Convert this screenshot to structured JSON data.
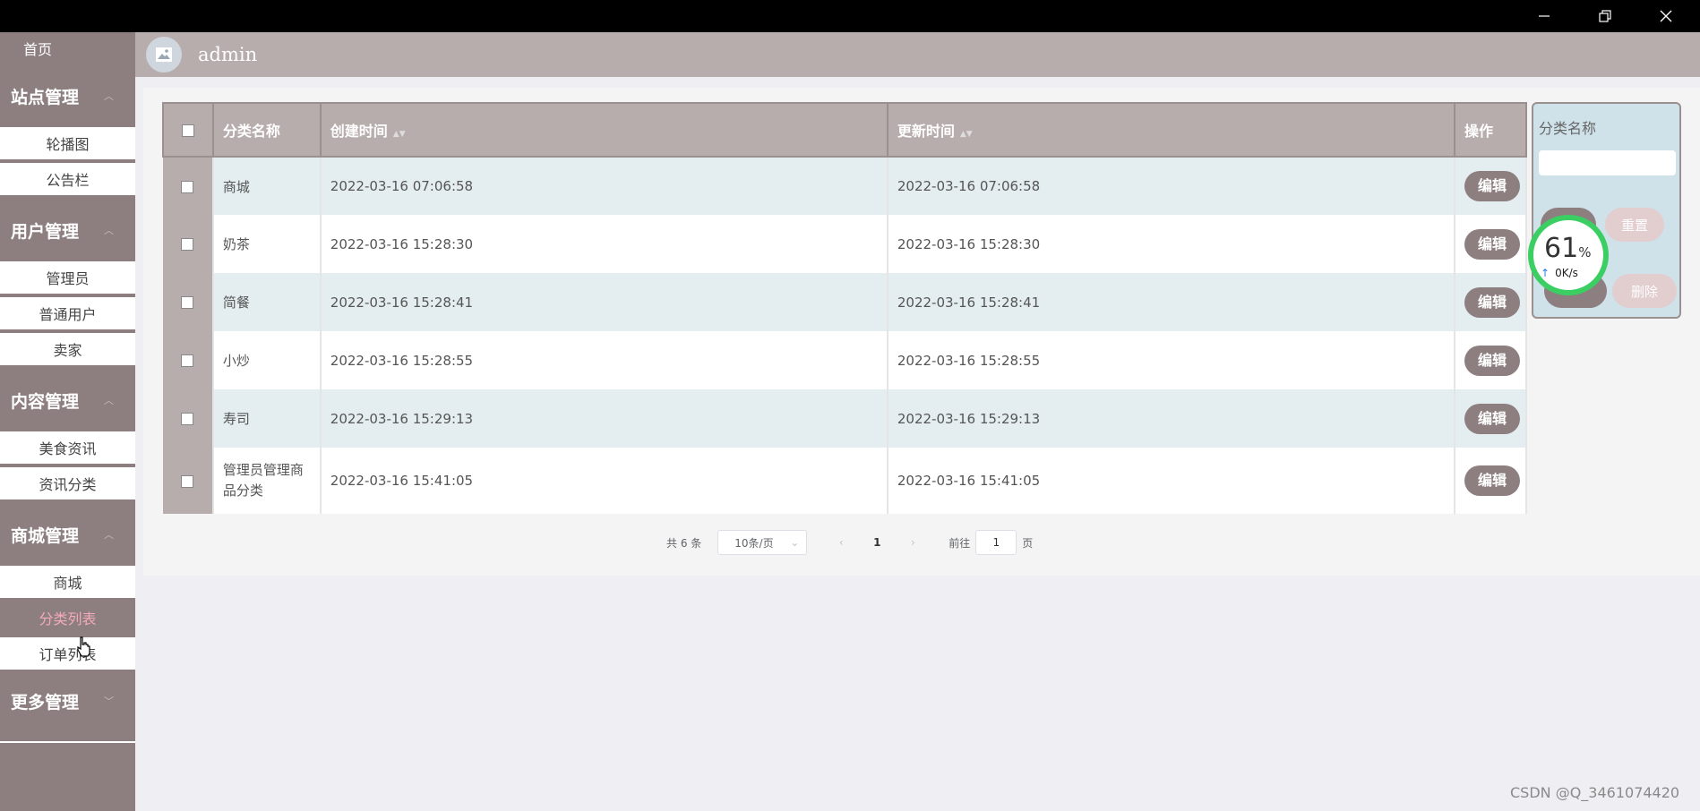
{
  "header": {
    "user": "admin"
  },
  "sidebar": {
    "home": "首页",
    "groups": [
      {
        "title": "站点管理",
        "items": [
          "轮播图",
          "公告栏"
        ]
      },
      {
        "title": "用户管理",
        "items": [
          "管理员",
          "普通用户",
          "卖家"
        ]
      },
      {
        "title": "内容管理",
        "items": [
          "美食资讯",
          "资讯分类"
        ]
      },
      {
        "title": "商城管理",
        "items": [
          "商城",
          "分类列表",
          "订单列表"
        ]
      },
      {
        "title": "更多管理",
        "items": []
      }
    ],
    "active_item": "分类列表"
  },
  "table": {
    "columns": [
      "分类名称",
      "创建时间",
      "更新时间",
      "操作"
    ],
    "rows": [
      {
        "name": "商城",
        "created": "2022-03-16 07:06:58",
        "updated": "2022-03-16 07:06:58",
        "action": "编辑"
      },
      {
        "name": "奶茶",
        "created": "2022-03-16 15:28:30",
        "updated": "2022-03-16 15:28:30",
        "action": "编辑"
      },
      {
        "name": "简餐",
        "created": "2022-03-16 15:28:41",
        "updated": "2022-03-16 15:28:41",
        "action": "编辑"
      },
      {
        "name": "小炒",
        "created": "2022-03-16 15:28:55",
        "updated": "2022-03-16 15:28:55",
        "action": "编辑"
      },
      {
        "name": "寿司",
        "created": "2022-03-16 15:29:13",
        "updated": "2022-03-16 15:29:13",
        "action": "编辑"
      },
      {
        "name": "管理员管理商品分类",
        "created": "2022-03-16 15:41:05",
        "updated": "2022-03-16 15:41:05",
        "action": "编辑"
      }
    ]
  },
  "pagination": {
    "total": "共 6 条",
    "page_size": "10条/页",
    "current_page": "1",
    "goto_prefix": "前往",
    "goto_value": "1",
    "goto_suffix": "页"
  },
  "search": {
    "label": "分类名称",
    "reset": "重置",
    "delete": "删除"
  },
  "speed_widget": {
    "percent": "61",
    "percent_sign": "%",
    "rate": "0K/s"
  },
  "watermark": "CSDN @Q_3461074420",
  "colors": {
    "brand": "#8d7f80",
    "header": "#b7adac",
    "active_text": "#f3aab9",
    "row_alt": "#e4eef1"
  }
}
